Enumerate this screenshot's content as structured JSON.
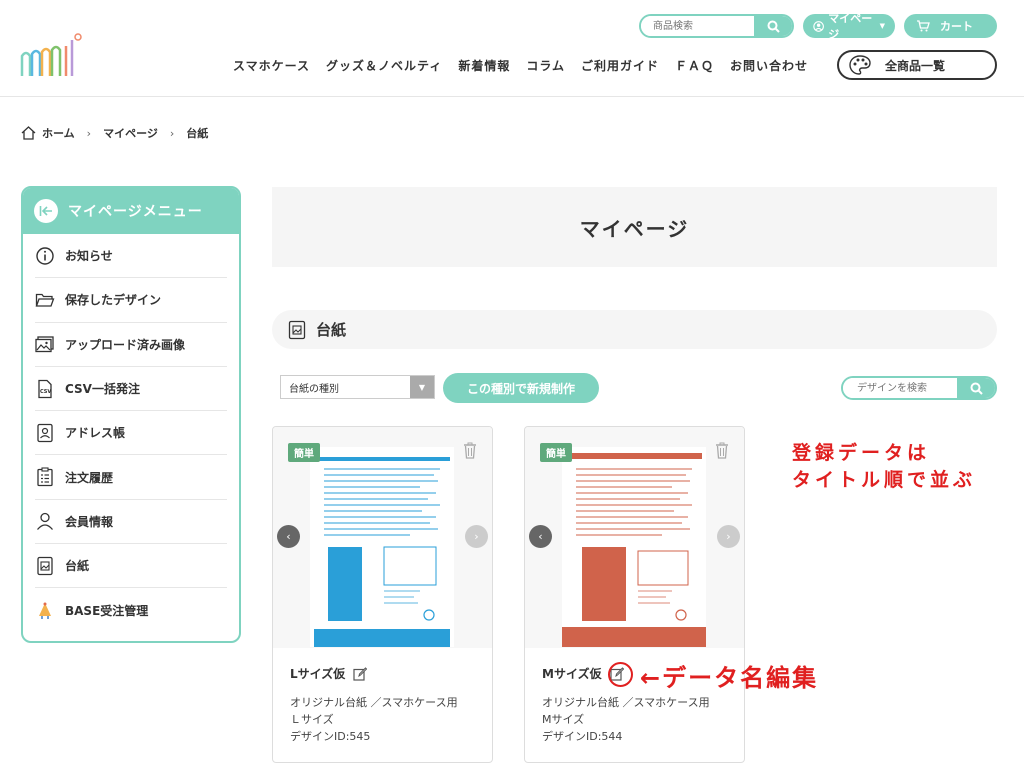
{
  "header": {
    "search_placeholder": "商品検索",
    "mypage_label": "マイページ",
    "cart_label": "カート",
    "nav": [
      "スマホケース",
      "グッズ＆ノベルティ",
      "新着情報",
      "コラム",
      "ご利用ガイド",
      "ＦＡＱ",
      "お問い合わせ"
    ],
    "all_products": "全商品一覧"
  },
  "breadcrumb": [
    "ホーム",
    "マイページ",
    "台紙"
  ],
  "sidebar": {
    "title": "マイページメニュー",
    "items": [
      {
        "label": "お知らせ",
        "icon": "info-icon"
      },
      {
        "label": "保存したデザイン",
        "icon": "folder-icon"
      },
      {
        "label": "アップロード済み画像",
        "icon": "images-icon"
      },
      {
        "label": "CSV一括発注",
        "icon": "csv-icon"
      },
      {
        "label": "アドレス帳",
        "icon": "address-book-icon"
      },
      {
        "label": "注文履歴",
        "icon": "order-list-icon"
      },
      {
        "label": "会員情報",
        "icon": "user-icon"
      },
      {
        "label": "台紙",
        "icon": "mount-icon"
      },
      {
        "label": "BASE受注管理",
        "icon": "base-icon"
      }
    ]
  },
  "main": {
    "page_title": "マイページ",
    "section_title": "台紙",
    "select_value": "台紙の種別",
    "new_button": "この種別で新規制作",
    "design_search_placeholder": "デザインを検索",
    "cards": [
      {
        "tag": "簡単",
        "name": "Lサイズ仮",
        "line1": "オリジナル台紙 ／スマホケース用",
        "line2": "Ｌサイズ",
        "design_id": "デザインID:545",
        "color": "#2a9fd8"
      },
      {
        "tag": "簡単",
        "name": "Mサイズ仮",
        "line1": "オリジナル台紙 ／スマホケース用",
        "line2": "Mサイズ",
        "design_id": "デザインID:544",
        "color": "#d0634b"
      }
    ]
  },
  "annotations": {
    "sort_note_1": "登録データは",
    "sort_note_2": "タイトル順で並ぶ",
    "edit_note": "←データ名編集"
  },
  "colors": {
    "accent": "#7fd3c0",
    "annotation": "#e02020"
  }
}
